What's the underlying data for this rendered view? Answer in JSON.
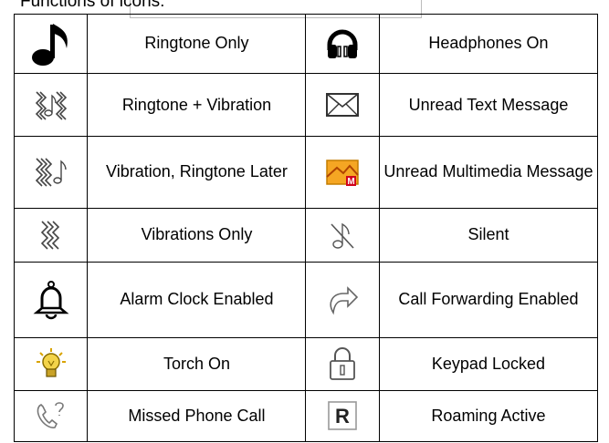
{
  "heading": "Functions of icons:",
  "rows": [
    {
      "left": {
        "icon": "music-note-icon",
        "label": "Ringtone Only"
      },
      "right": {
        "icon": "headphones-icon",
        "label": "Headphones On"
      }
    },
    {
      "left": {
        "icon": "ringtone-vibration-icon",
        "label": "Ringtone + Vibration"
      },
      "right": {
        "icon": "envelope-icon",
        "label": "Unread Text Message"
      }
    },
    {
      "left": {
        "icon": "vibration-ringtone-later-icon",
        "label": "Vibration, Ringtone Later"
      },
      "right": {
        "icon": "mms-envelope-icon",
        "label": "Unread Multimedia Message"
      }
    },
    {
      "left": {
        "icon": "vibration-icon",
        "label": "Vibrations Only"
      },
      "right": {
        "icon": "silent-icon",
        "label": "Silent"
      }
    },
    {
      "left": {
        "icon": "alarm-bell-icon",
        "label": "Alarm Clock Enabled"
      },
      "right": {
        "icon": "call-forward-arrow-icon",
        "label": "Call Forwarding Enabled"
      }
    },
    {
      "left": {
        "icon": "torch-bulb-icon",
        "label": "Torch On"
      },
      "right": {
        "icon": "padlock-icon",
        "label": "Keypad Locked"
      }
    },
    {
      "left": {
        "icon": "missed-call-icon",
        "label": "Missed Phone Call"
      },
      "right": {
        "icon": "roaming-r-icon",
        "label": "Roaming Active",
        "glyph": "R"
      }
    }
  ],
  "colors": {
    "mms_envelope": "#f5a623",
    "mms_badge": "#d0021b",
    "bulb": "#e8c21a"
  }
}
